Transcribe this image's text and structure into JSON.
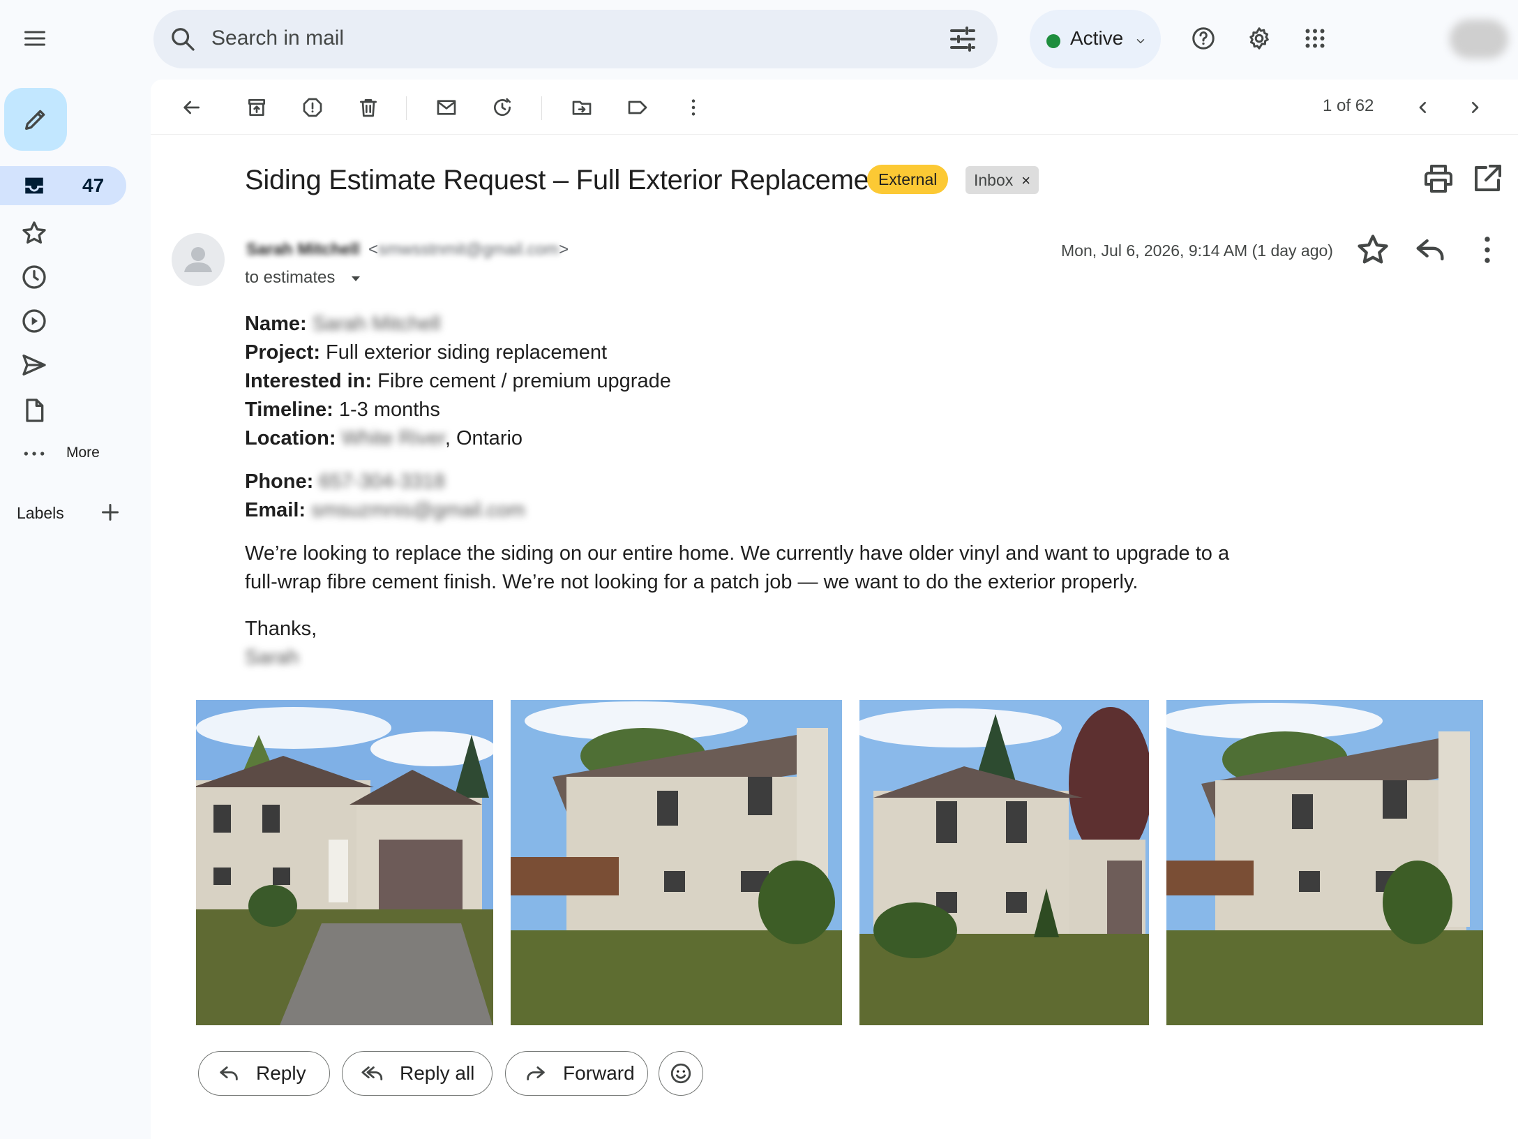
{
  "topbar": {
    "search_placeholder": "Search in mail",
    "status_label": "Active",
    "status_color": "#1e8e3e",
    "icons": [
      "menu-icon",
      "search-icon",
      "filter-options-icon",
      "help-icon",
      "gear-icon",
      "apps-grid-icon"
    ]
  },
  "sidebar": {
    "inbox_count": "47",
    "more_label": "More",
    "labels_heading": "Labels",
    "icons": [
      "pencil-icon",
      "inbox-icon",
      "star-icon",
      "clock-icon",
      "important-icon",
      "send-icon",
      "draft-icon",
      "more-dots-icon",
      "plus-icon"
    ]
  },
  "toolbar": {
    "pager": "1 of 62",
    "icons": [
      "back-arrow-icon",
      "archive-icon",
      "report-spam-icon",
      "trash-icon",
      "mark-unread-icon",
      "snooze-icon",
      "move-to-icon",
      "label-icon",
      "more-vert-icon",
      "chevron-left-icon",
      "chevron-right-icon"
    ]
  },
  "message": {
    "subject": "Siding Estimate Request – Full Exterior Replacement",
    "chip_external": "External",
    "chip_inbox": "Inbox",
    "chip_inbox_close": "×",
    "sender_name": "Sarah Mitchell",
    "sender_email_open": "<",
    "sender_email": "smwsstnmit@gmail.com",
    "sender_email_close": ">",
    "to_line": "to estimates",
    "date": "Mon, Jul 6, 2026, 9:14 AM (1 day ago)",
    "fields": {
      "name_label": "Name:",
      "name_value": "Sarah Mitchell",
      "project_label": "Project:",
      "project_value": "Full exterior siding replacement",
      "interested_label": "Interested in:",
      "interested_value": "Fibre cement / premium upgrade",
      "timeline_label": "Timeline:",
      "timeline_value": "1-3 months",
      "location_label": "Location:",
      "location_blurred": "White River",
      "location_value": ", Ontario",
      "phone_label": "Phone:",
      "phone_value": "657-304-3318",
      "email_label": "Email:",
      "email_value": "smsuzmnis@gmail.com"
    },
    "paragraph": "We’re looking to replace the siding on our entire home. We currently have older vinyl and want to upgrade to a full-wrap fibre cement finish. We’re not looking for a patch job — we want to do the exterior properly.",
    "signoff": "Thanks,",
    "signature": "Sarah",
    "attachments": [
      "house-photo-front-garage",
      "house-photo-side-deck",
      "house-photo-front-angle",
      "house-photo-side-deck-2"
    ]
  },
  "actions": {
    "reply": "Reply",
    "reply_all": "Reply all",
    "forward": "Forward",
    "emoji_icon": "emoji-icon"
  }
}
